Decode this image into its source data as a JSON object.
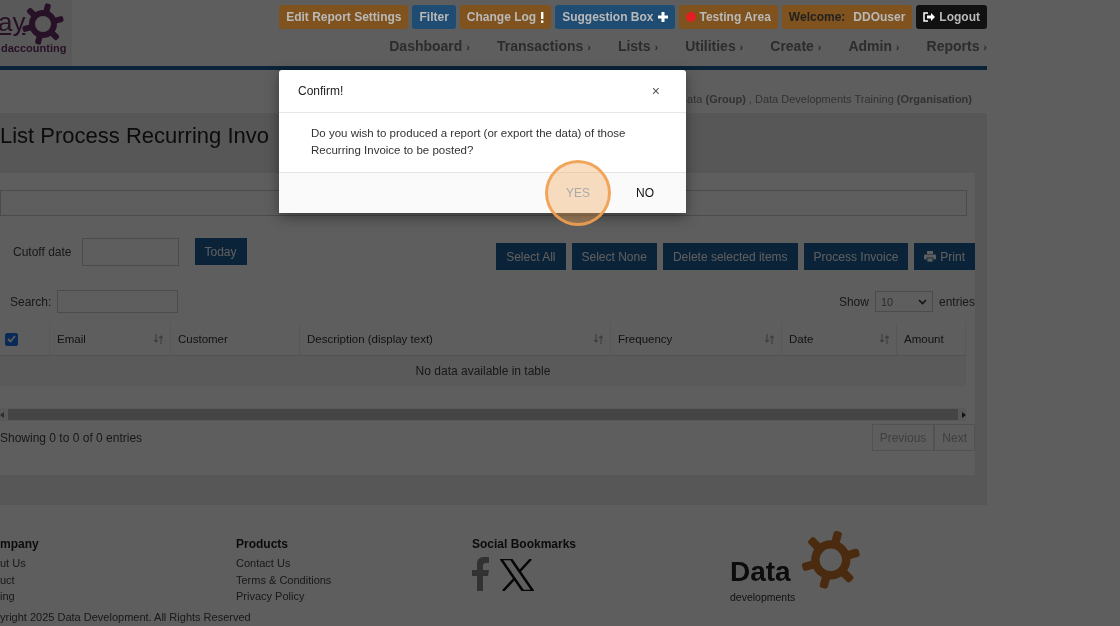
{
  "logo": {
    "text": "ay",
    "subtext": "daccounting"
  },
  "top_buttons": [
    {
      "label": "Edit Report Settings",
      "kind": "plain",
      "color": "#7f521e"
    },
    {
      "label": "Filter",
      "kind": "plain",
      "color": "#1f4c72"
    },
    {
      "label": "Change Log",
      "kind": "alert",
      "color": "#7f521e"
    },
    {
      "label": "Suggestion Box",
      "kind": "add",
      "color": "#1f4c72"
    },
    {
      "label": "Testing Area",
      "kind": "status",
      "color": "#7f521e"
    },
    {
      "label": "Welcome:",
      "user": "DDOuser",
      "kind": "user",
      "color": "#7f521e"
    },
    {
      "label": "Logout",
      "kind": "logout",
      "color": "#111111"
    }
  ],
  "nav": [
    {
      "label": "Dashboard",
      "caret": "›"
    },
    {
      "label": "Transactions",
      "caret": "›"
    },
    {
      "label": "Lists",
      "caret": "›"
    },
    {
      "label": "Utilities",
      "caret": "›"
    },
    {
      "label": "Create",
      "caret": "›"
    },
    {
      "label": "Admin",
      "caret": "›"
    },
    {
      "label": "Reports",
      "caret": "›"
    }
  ],
  "breadcrumb": "ata **(Group)** , Data Developments Training **(Organisation)**",
  "page_title": "List Process Recurring Invo",
  "cutoff": {
    "label": "Cutoff date",
    "button": "Today"
  },
  "actions": [
    {
      "label": "Select All",
      "kind": "plain"
    },
    {
      "label": "Select None",
      "kind": "plain"
    },
    {
      "label": "Delete selected items",
      "kind": "plain"
    },
    {
      "label": "Process Invoice",
      "kind": "plain"
    },
    {
      "label": "Print",
      "kind": "print"
    }
  ],
  "search": {
    "label": "Search:"
  },
  "length": {
    "before": "Show",
    "value": "10",
    "after": "entries"
  },
  "table": {
    "select_all_checked": true,
    "columns": [
      {
        "label": "Email",
        "sortable": true
      },
      {
        "label": "Customer",
        "sortable": false
      },
      {
        "label": "Description (display text)",
        "sortable": true
      },
      {
        "label": "Frequency",
        "sortable": true
      },
      {
        "label": "Date",
        "sortable": true
      },
      {
        "label": "Amount",
        "sortable": false
      }
    ],
    "empty_message": "No data available in table"
  },
  "info": "Showing 0 to 0 of 0 entries",
  "pager": [
    {
      "label": "Previous",
      "disabled": true
    },
    {
      "label": "Next",
      "disabled": true
    }
  ],
  "footer": {
    "columns": [
      {
        "heading": "mpany",
        "links": [
          "ut Us",
          "uct",
          "ing"
        ]
      },
      {
        "heading": "Products",
        "links": [
          "Contact Us",
          "Terms & Conditions",
          "Privacy Policy"
        ]
      }
    ],
    "social": {
      "heading": "Social Bookmarks"
    },
    "brand": {
      "name": "Data",
      "tagline": "developments"
    },
    "copyright": "yright 2025 Data Development. All Rights Reserved"
  },
  "dialog": {
    "title": "Confirm!",
    "close": "×",
    "message": "Do you wish to produced a report (or export the data) of those Recurring Invoice to be posted?",
    "buttons": [
      {
        "label": "YES",
        "highlighted": true
      },
      {
        "label": "NO",
        "highlighted": false
      }
    ]
  }
}
